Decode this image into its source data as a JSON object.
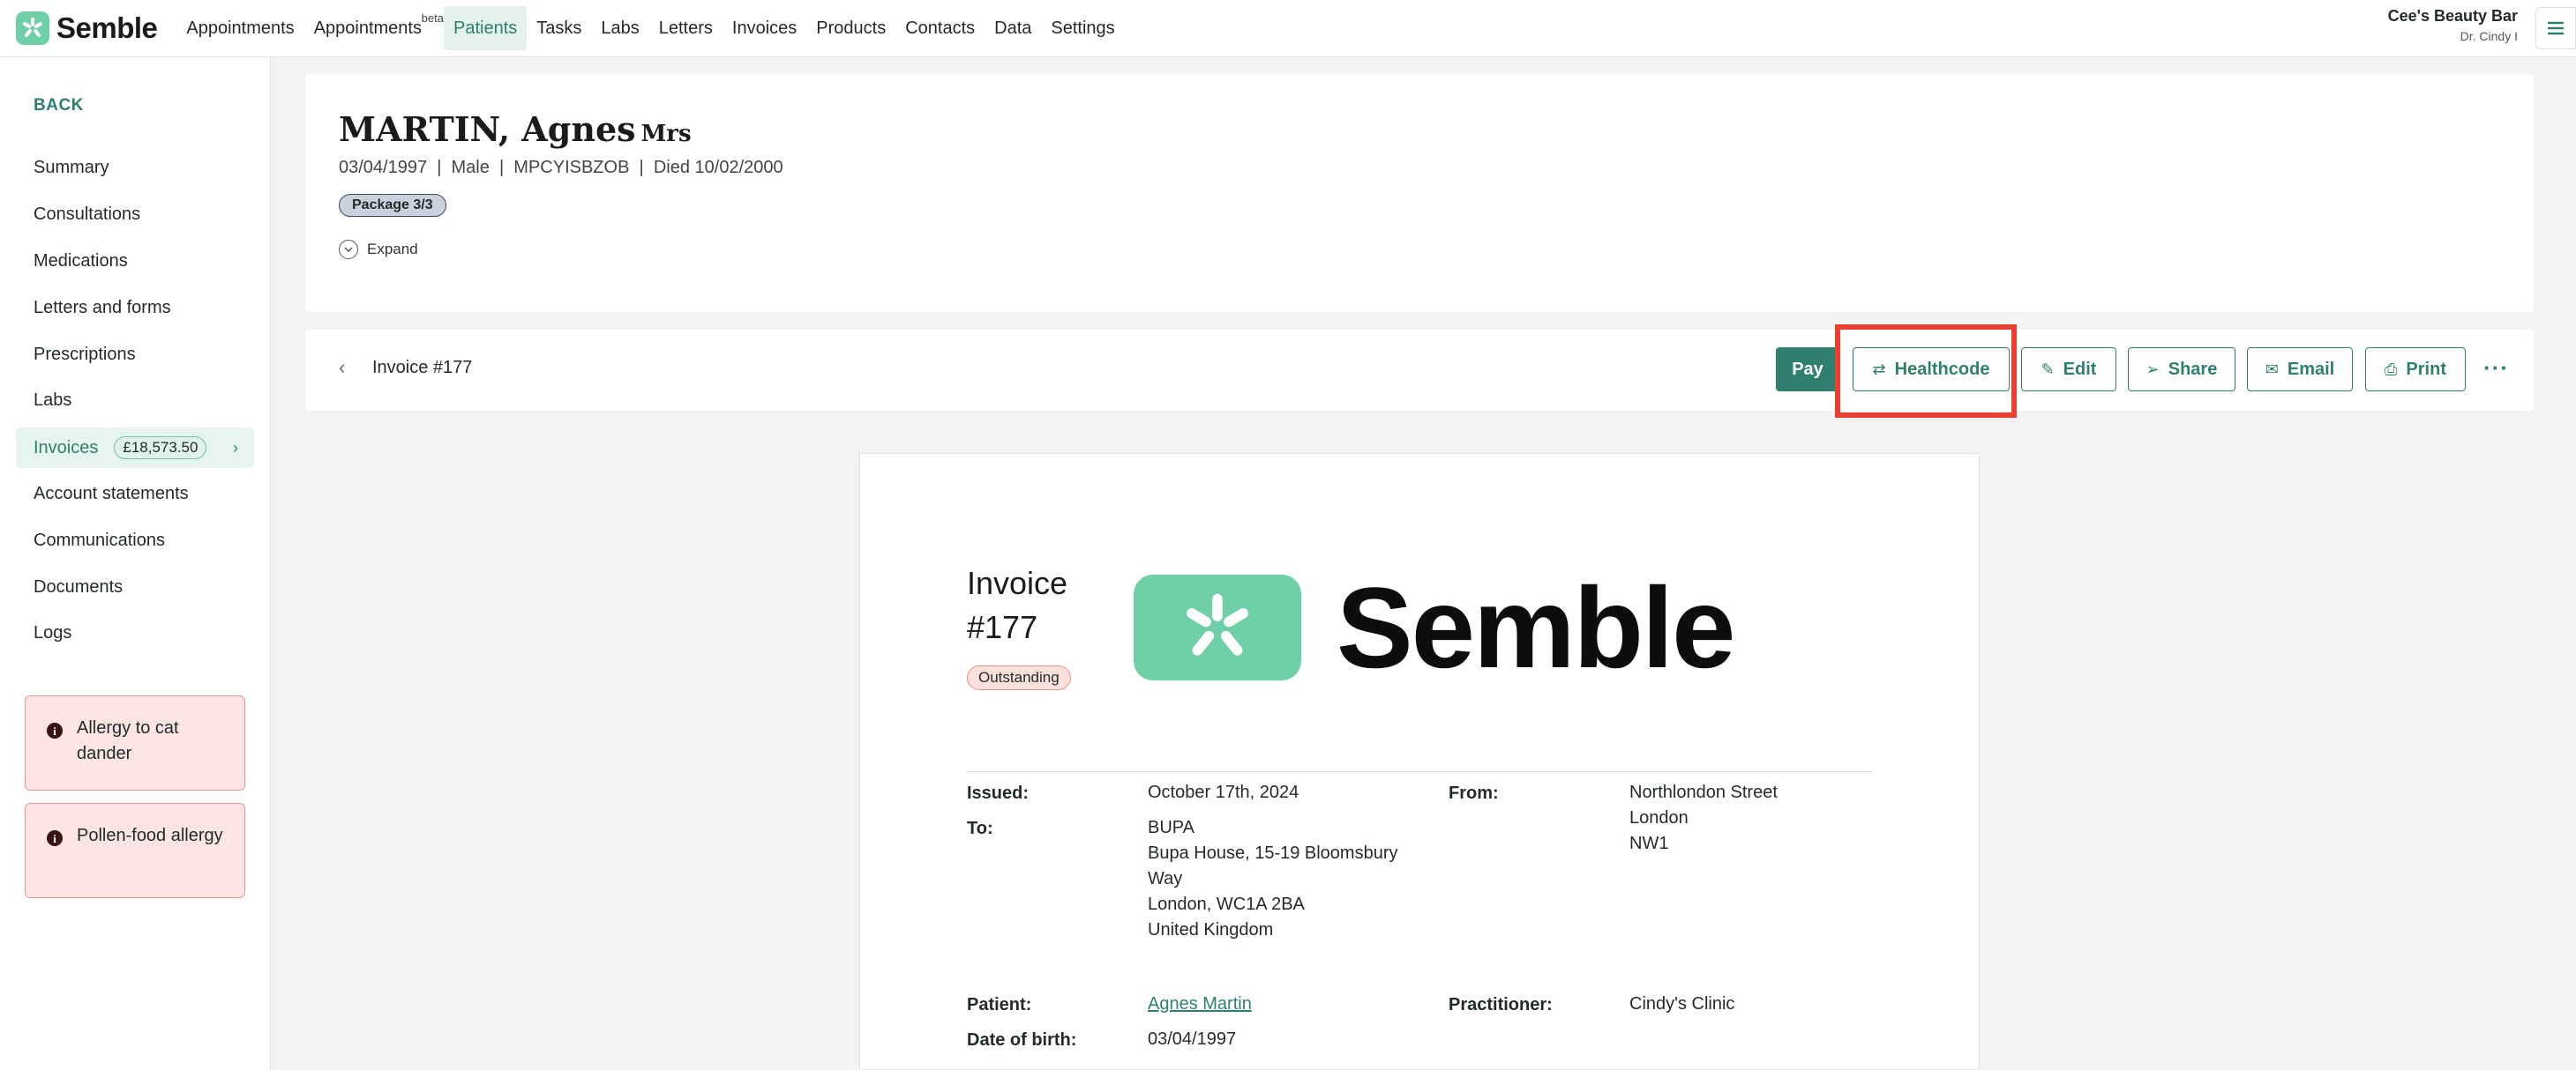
{
  "brand": {
    "name": "Semble",
    "accent": "#2f7f71",
    "logo_bg": "#6fcfa7"
  },
  "nav": {
    "items": [
      {
        "label": "Appointments"
      },
      {
        "label": "Appointments",
        "badge": "beta"
      },
      {
        "label": "Patients",
        "active": true
      },
      {
        "label": "Tasks"
      },
      {
        "label": "Labs"
      },
      {
        "label": "Letters"
      },
      {
        "label": "Invoices"
      },
      {
        "label": "Products"
      },
      {
        "label": "Contacts"
      },
      {
        "label": "Data"
      },
      {
        "label": "Settings"
      }
    ],
    "org_name": "Cee's Beauty Bar",
    "org_user": "Dr. Cindy I",
    "menu_icon": "hamburger-icon"
  },
  "sidebar": {
    "back_label": "BACK",
    "items": [
      {
        "label": "Summary"
      },
      {
        "label": "Consultations"
      },
      {
        "label": "Medications"
      },
      {
        "label": "Letters and forms"
      },
      {
        "label": "Prescriptions"
      },
      {
        "label": "Labs"
      },
      {
        "label": "Invoices",
        "badge": "£18,573.50",
        "active": true
      },
      {
        "label": "Account statements"
      },
      {
        "label": "Communications"
      },
      {
        "label": "Documents"
      },
      {
        "label": "Logs"
      }
    ],
    "alerts": [
      {
        "text": "Allergy to cat dander"
      },
      {
        "text": "Pollen-food allergy"
      }
    ]
  },
  "patient": {
    "name": "MARTIN, Agnes",
    "title": "Mrs",
    "meta": "03/04/1997  |  Male  |  MPCYISBZOB  |  Died 10/02/2000",
    "package": "Package 3/3",
    "expand_label": "Expand"
  },
  "invoice_bar": {
    "title": "Invoice #177",
    "buttons": {
      "pay": "Pay",
      "healthcode": "Healthcode",
      "edit": "Edit",
      "share": "Share",
      "email": "Email",
      "print": "Print"
    },
    "more": "···"
  },
  "invoice": {
    "title_line1": "Invoice",
    "title_line2": "#177",
    "status": "Outstanding",
    "logo_text": "Semble",
    "issued_label": "Issued:",
    "issued_value": "October 17th, 2024",
    "to_label": "To:",
    "to_lines": [
      "BUPA",
      "Bupa House, 15-19 Bloomsbury",
      "Way",
      "London, WC1A 2BA",
      "United Kingdom"
    ],
    "from_label": "From:",
    "from_lines": [
      "Northlondon Street",
      "London",
      "NW1"
    ],
    "patient_label": "Patient:",
    "patient_value": "Agnes Martin",
    "practitioner_label": "Practitioner:",
    "practitioner_value": "Cindy's Clinic",
    "dob_label": "Date of birth:",
    "dob_value": "03/04/1997"
  }
}
